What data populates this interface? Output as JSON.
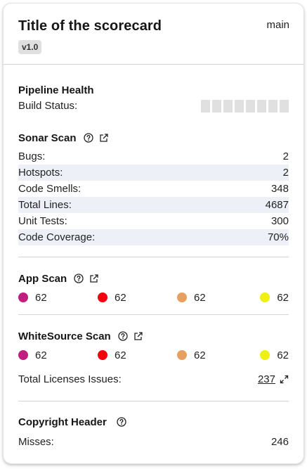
{
  "header": {
    "title": "Title of the scorecard",
    "version": "v1.0",
    "branch": "main"
  },
  "pipeline": {
    "title": "Pipeline Health",
    "build_status_label": "Build Status:"
  },
  "sonar": {
    "title": "Sonar Scan",
    "rows": [
      {
        "label": "Bugs:",
        "value": "2"
      },
      {
        "label": "Hotspots:",
        "value": "2"
      },
      {
        "label": "Code Smells:",
        "value": "348"
      },
      {
        "label": "Total Lines:",
        "value": "4687"
      },
      {
        "label": "Unit Tests:",
        "value": "300"
      },
      {
        "label": "Code Coverage:",
        "value": "70%"
      }
    ]
  },
  "appscan": {
    "title": "App Scan",
    "counts": [
      {
        "value": "62",
        "color": "#c21e80"
      },
      {
        "value": "62",
        "color": "#f5000d"
      },
      {
        "value": "62",
        "color": "#e8a060"
      },
      {
        "value": "62",
        "color": "#eef00f"
      }
    ]
  },
  "whitesource": {
    "title": "WhiteSource Scan",
    "counts": [
      {
        "value": "62",
        "color": "#c21e80"
      },
      {
        "value": "62",
        "color": "#f5000d"
      },
      {
        "value": "62",
        "color": "#e8a060"
      },
      {
        "value": "62",
        "color": "#eef00f"
      }
    ],
    "licenses_label": "Total Licenses Issues:",
    "licenses_value": "237"
  },
  "copyright": {
    "title": "Copyright Header",
    "misses_label": "Misses:",
    "misses_value": "246"
  }
}
